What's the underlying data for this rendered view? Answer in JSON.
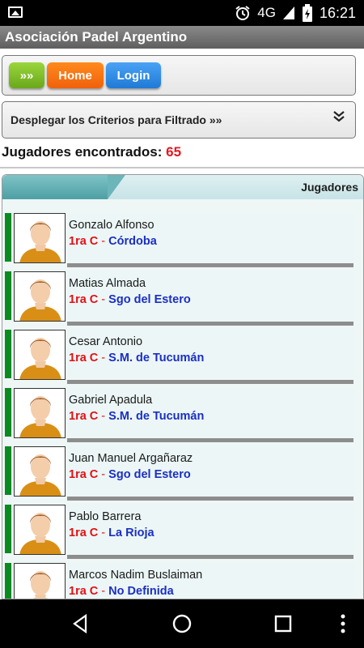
{
  "status": {
    "network": "4G",
    "time": "16:21"
  },
  "app": {
    "title": "Asociación Padel Argentino"
  },
  "nav": {
    "more_label": "»»",
    "home_label": "Home",
    "login_label": "Login"
  },
  "filter": {
    "label": "Desplegar los Criterios para Filtrado »»",
    "chevron": "⌄"
  },
  "results": {
    "label": "Jugadores encontrados:",
    "count": "65"
  },
  "panel": {
    "title": "Jugadores"
  },
  "players": [
    {
      "name": "Gonzalo Alfonso",
      "category": "1ra C",
      "location": "Córdoba"
    },
    {
      "name": "Matias Almada",
      "category": "1ra C",
      "location": "Sgo del Estero"
    },
    {
      "name": "Cesar Antonio",
      "category": "1ra C",
      "location": "S.M. de Tucumán"
    },
    {
      "name": "Gabriel Apadula",
      "category": "1ra C",
      "location": "S.M. de Tucumán"
    },
    {
      "name": "Juan Manuel Argañaraz",
      "category": "1ra C",
      "location": "Sgo del Estero"
    },
    {
      "name": "Pablo Barrera",
      "category": "1ra C",
      "location": "La Rioja"
    },
    {
      "name": "Marcos Nadim Buslaiman",
      "category": "1ra C",
      "location": "No Definida"
    }
  ],
  "icons": {
    "image": "image-icon",
    "alarm": "alarm-icon",
    "signal": "signal-icon",
    "battery": "battery-icon",
    "back": "back-icon",
    "home": "home-circle-icon",
    "recents": "recents-icon",
    "menu": "overflow-menu-icon",
    "avatar": "avatar-icon"
  },
  "colors": {
    "more_button": "#7bbd25",
    "home_button": "#f46f12",
    "login_button": "#2b86e0",
    "count": "#e4171f",
    "category": "#e20f14",
    "location": "#1a2fc2",
    "row_bar": "#0a8a20"
  }
}
